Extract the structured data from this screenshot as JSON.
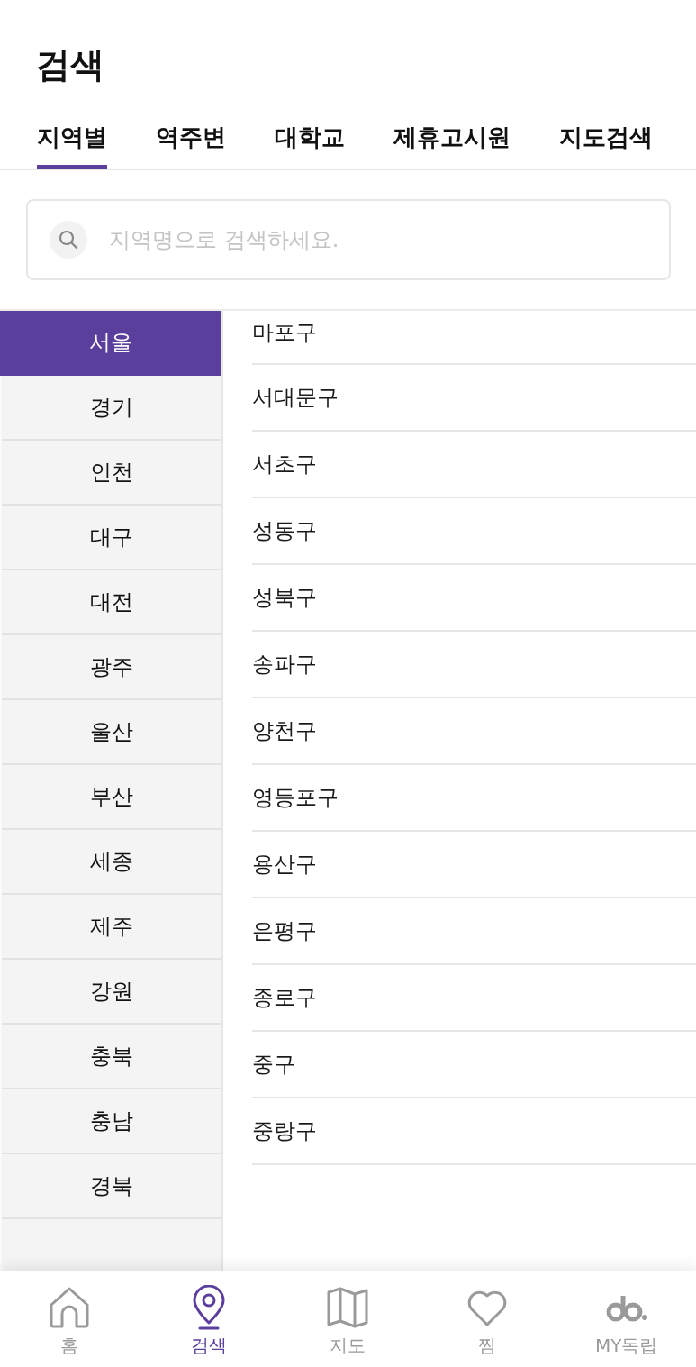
{
  "header": {
    "title": "검색"
  },
  "tabs": [
    {
      "label": "지역별",
      "selected": true
    },
    {
      "label": "역주변",
      "selected": false
    },
    {
      "label": "대학교",
      "selected": false
    },
    {
      "label": "제휴고시원",
      "selected": false
    },
    {
      "label": "지도검색",
      "selected": false
    }
  ],
  "search": {
    "placeholder": "지역명으로 검색하세요."
  },
  "regions": [
    {
      "label": "서울",
      "selected": true
    },
    {
      "label": "경기",
      "selected": false
    },
    {
      "label": "인천",
      "selected": false
    },
    {
      "label": "대구",
      "selected": false
    },
    {
      "label": "대전",
      "selected": false
    },
    {
      "label": "광주",
      "selected": false
    },
    {
      "label": "울산",
      "selected": false
    },
    {
      "label": "부산",
      "selected": false
    },
    {
      "label": "세종",
      "selected": false
    },
    {
      "label": "제주",
      "selected": false
    },
    {
      "label": "강원",
      "selected": false
    },
    {
      "label": "충북",
      "selected": false
    },
    {
      "label": "충남",
      "selected": false
    },
    {
      "label": "경북",
      "selected": false
    }
  ],
  "districts": [
    "마포구",
    "서대문구",
    "서초구",
    "성동구",
    "성북구",
    "송파구",
    "양천구",
    "영등포구",
    "용산구",
    "은평구",
    "종로구",
    "중구",
    "중랑구"
  ],
  "bottom_nav": [
    {
      "kind": "home",
      "label": "홈",
      "selected": false
    },
    {
      "kind": "pin",
      "label": "검색",
      "selected": true
    },
    {
      "kind": "map",
      "label": "지도",
      "selected": false
    },
    {
      "kind": "heart",
      "label": "찜",
      "selected": false
    },
    {
      "kind": "logo",
      "label": "MY독립",
      "selected": false
    }
  ]
}
